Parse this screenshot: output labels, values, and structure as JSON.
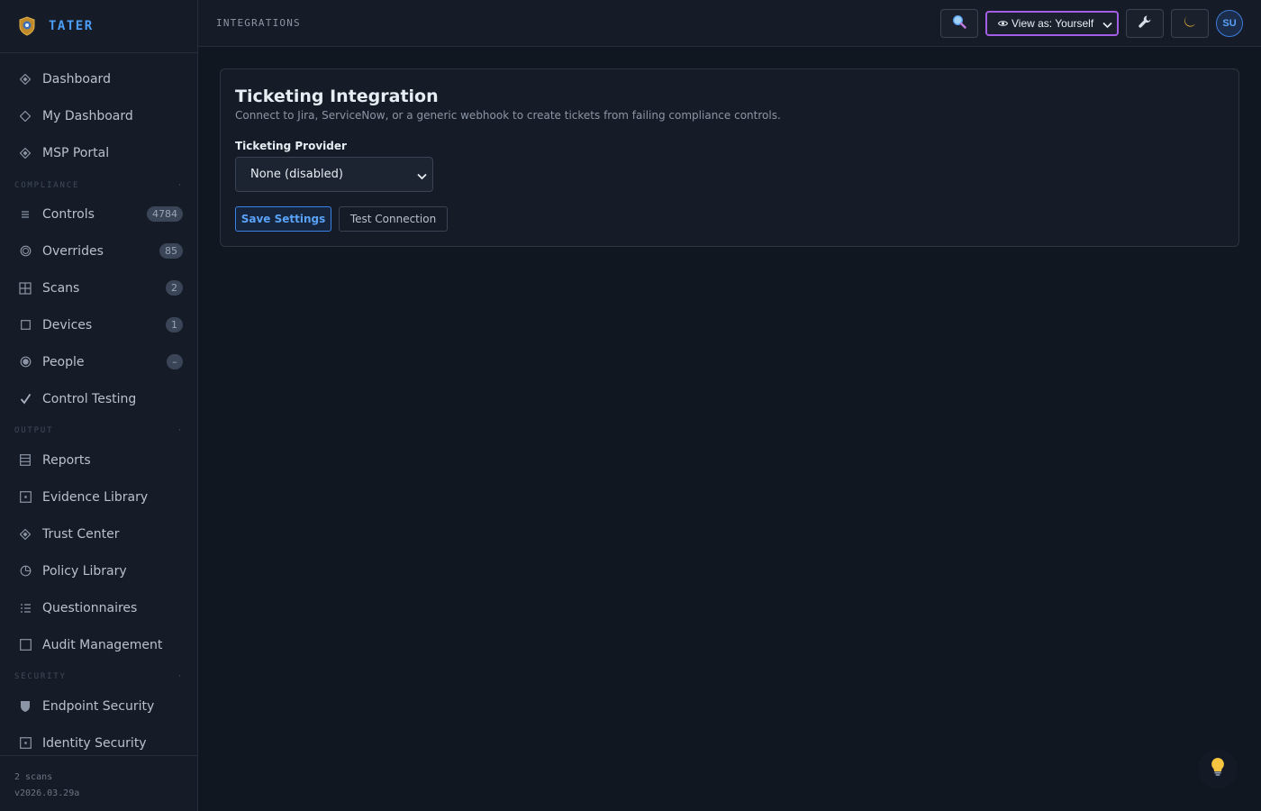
{
  "app": {
    "name": "TATER"
  },
  "header": {
    "title": "INTEGRATIONS",
    "view_as_label": "View as: Yourself",
    "avatar_initials": "SU"
  },
  "sidebar": {
    "items": [
      {
        "label": "Dashboard",
        "icon": "diamond-filled-icon"
      },
      {
        "label": "My Dashboard",
        "icon": "diamond-outline-icon"
      },
      {
        "label": "MSP Portal",
        "icon": "diamond-filled-icon"
      },
      {
        "label": "Controls",
        "icon": "list-lines-icon",
        "badge": "4784"
      },
      {
        "label": "Overrides",
        "icon": "ring-icon",
        "badge": "85"
      },
      {
        "label": "Scans",
        "icon": "grid-icon",
        "badge": "2"
      },
      {
        "label": "Devices",
        "icon": "square-outline-icon",
        "badge": "1"
      },
      {
        "label": "People",
        "icon": "target-icon",
        "badge": "–"
      },
      {
        "label": "Control Testing",
        "icon": "checkmark-icon"
      },
      {
        "label": "Reports",
        "icon": "document-lines-icon"
      },
      {
        "label": "Evidence Library",
        "icon": "square-dot-icon"
      },
      {
        "label": "Trust Center",
        "icon": "diamond-filled-icon"
      },
      {
        "label": "Policy Library",
        "icon": "clock-icon"
      },
      {
        "label": "Questionnaires",
        "icon": "checklist-icon"
      },
      {
        "label": "Audit Management",
        "icon": "square-outline-icon"
      },
      {
        "label": "Endpoint Security",
        "icon": "shield-icon"
      },
      {
        "label": "Identity Security",
        "icon": "square-dot-icon"
      }
    ],
    "sections": {
      "compliance": "COMPLIANCE",
      "output": "OUTPUT",
      "security": "SECURITY"
    },
    "footer": {
      "scans": "2 scans",
      "version": "v2026.03.29a"
    }
  },
  "main": {
    "card": {
      "title": "Ticketing Integration",
      "subtitle": "Connect to Jira, ServiceNow, or a generic webhook to create tickets from failing compliance controls.",
      "provider_label": "Ticketing Provider",
      "provider_value": "None (disabled)",
      "save_label": "Save Settings",
      "test_label": "Test Connection"
    }
  },
  "colors": {
    "accent": "#4c9df5",
    "view_as_border": "#a45ee5",
    "background": "#111720"
  }
}
